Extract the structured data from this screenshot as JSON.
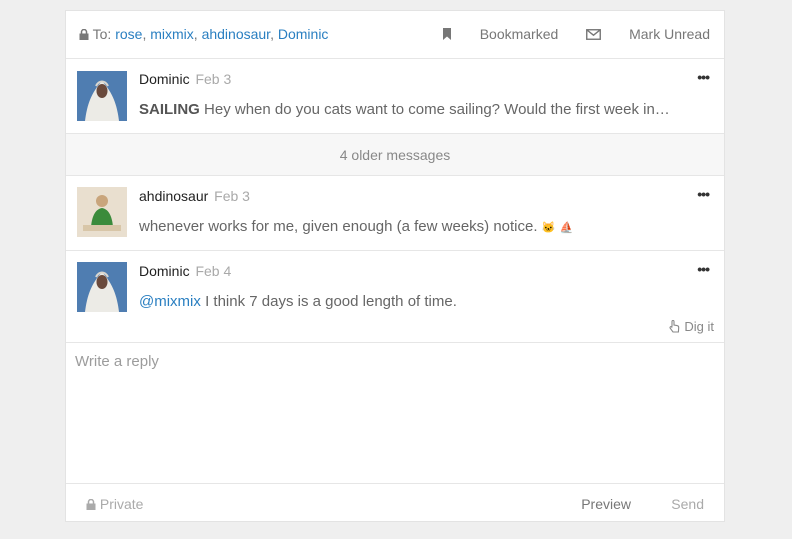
{
  "header": {
    "to_label": "To:",
    "recipients": [
      "rose",
      "mixmix",
      "ahdinosaur",
      "Dominic"
    ],
    "bookmarked_label": "Bookmarked",
    "mark_unread_label": "Mark Unread"
  },
  "messages": [
    {
      "author": "Dominic",
      "date": "Feb 3",
      "bold_prefix": "SAILING",
      "text": "Hey when do you cats want to come sailing? Would the first week in…"
    },
    {
      "author": "ahdinosaur",
      "date": "Feb 3",
      "text": "whenever works for me, given enough (a few weeks) notice."
    },
    {
      "author": "Dominic",
      "date": "Feb 4",
      "mention": "@mixmix",
      "text": "I think 7 days is a good length of time."
    }
  ],
  "older_messages_label": "4 older messages",
  "dig_it_label": "Dig it",
  "reply": {
    "placeholder": "Write a reply"
  },
  "footer": {
    "private_label": "Private",
    "preview_label": "Preview",
    "send_label": "Send"
  }
}
